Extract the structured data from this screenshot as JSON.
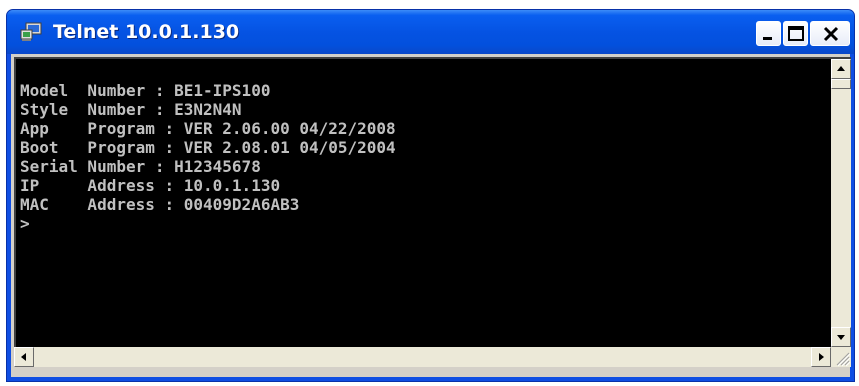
{
  "window": {
    "title": "Telnet 10.0.1.130",
    "icon": "telnet-computer-icon",
    "controls": [
      "minimize",
      "maximize",
      "close"
    ]
  },
  "terminal": {
    "lines": [
      "Model  Number : BE1-IPS100",
      "Style  Number : E3N2N4N",
      "App    Program : VER 2.06.00 04/22/2008",
      "Boot   Program : VER 2.08.01 04/05/2004",
      "Serial Number : H12345678",
      "IP     Address : 10.0.1.130",
      "MAC    Address : 00409D2A6AB3",
      ">"
    ]
  },
  "colors": {
    "titlebar": "#0553e3",
    "terminal_bg": "#000000",
    "terminal_text": "#c0c0c0",
    "close_button": "#ffffff"
  }
}
